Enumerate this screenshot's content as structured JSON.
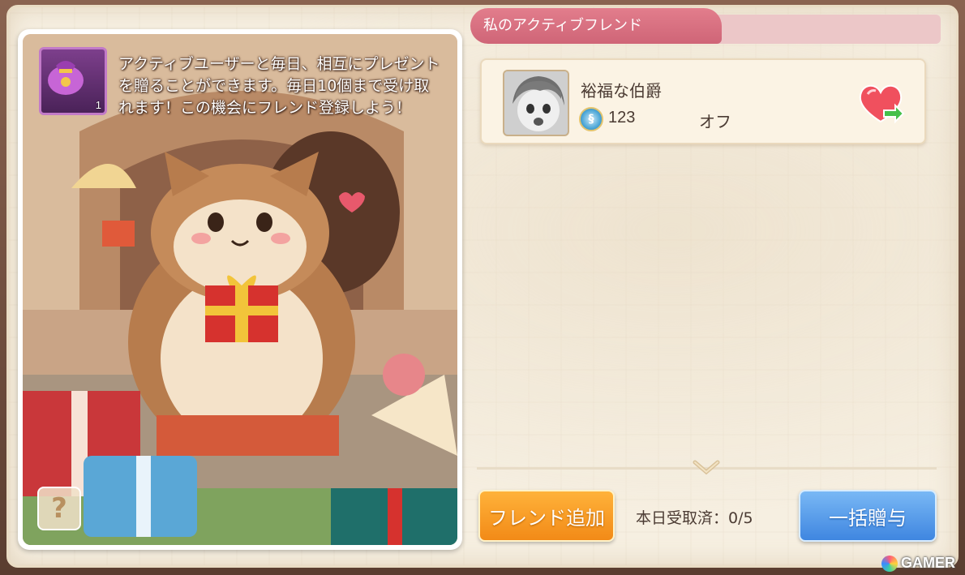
{
  "panel": {
    "title": "私のアクティブフレンド"
  },
  "intro": {
    "item_count": "1",
    "description": "アクティブユーザーと毎日、相互にプレゼントを贈ることができます。毎日10個まで受け取れます！この機会にフレンド登録しよう！"
  },
  "help": {
    "label": "?"
  },
  "friends": [
    {
      "name": "裕福な伯爵",
      "level": "123",
      "status": "オフ"
    }
  ],
  "actions": {
    "add_friend_label": "フレンド追加",
    "received_today": "本日受取済：0/5",
    "gift_all_label": "一括贈与"
  },
  "watermark": {
    "text": "GAMER"
  },
  "colors": {
    "title_tab": "#d96d7f",
    "add_button": "#f59a24",
    "gift_all_button": "#4f94e6"
  }
}
